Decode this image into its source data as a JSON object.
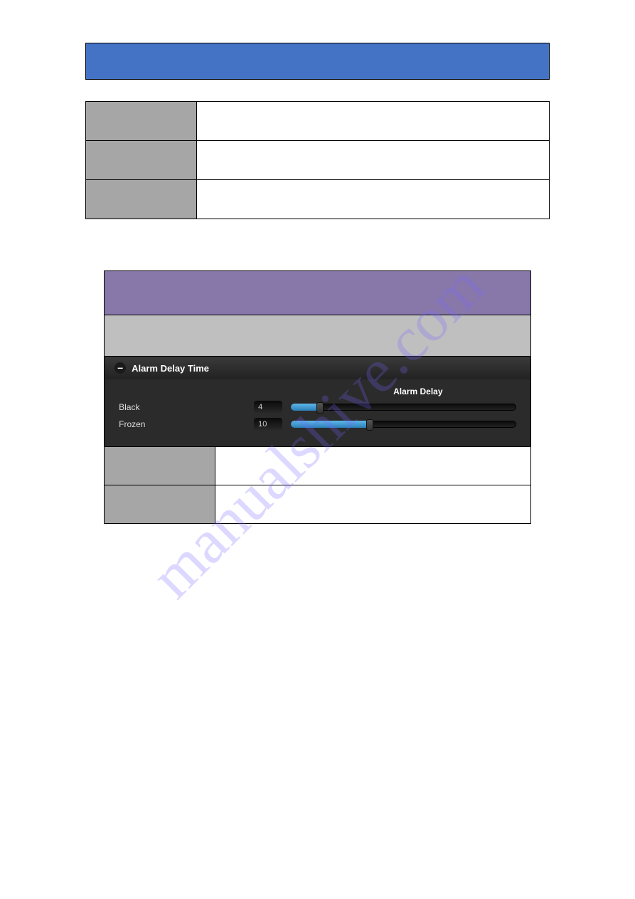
{
  "watermark": "manualshive.com",
  "panel": {
    "title": "Alarm Delay Time",
    "collapse_glyph": "–",
    "col_header": "Alarm Delay",
    "rows": [
      {
        "label": "Black",
        "value": "4"
      },
      {
        "label": "Frozen",
        "value": "10"
      }
    ]
  }
}
